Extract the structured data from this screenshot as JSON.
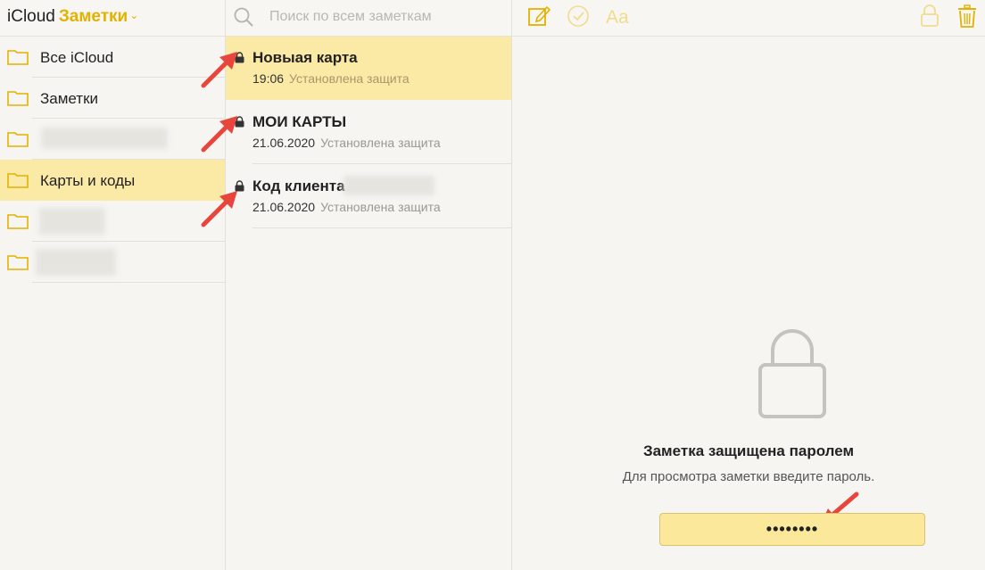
{
  "header": {
    "brand_icloud": "iCloud",
    "brand_notes": "Заметки",
    "brand_chevron": "⌄",
    "search_placeholder": "Поиск по всем заметкам"
  },
  "sidebar": {
    "folders": [
      {
        "label": "Все iCloud",
        "active": false
      },
      {
        "label": "Заметки",
        "active": false
      },
      {
        "label": "",
        "active": false,
        "redacted": true
      },
      {
        "label": "Карты и коды",
        "active": true
      },
      {
        "label": "",
        "active": false,
        "redacted": true
      },
      {
        "label": "",
        "active": false,
        "redacted": true
      }
    ]
  },
  "notes": [
    {
      "title": "Новыая карта",
      "date": "19:06",
      "status": "Установлена защита",
      "locked": true,
      "active": true
    },
    {
      "title": "МОИ КАРТЫ",
      "date": "21.06.2020",
      "status": "Установлена защита",
      "locked": true,
      "active": false
    },
    {
      "title": "Код клиента",
      "date": "21.06.2020",
      "status": "Установлена защита",
      "locked": true,
      "active": false,
      "title_partially_redacted": true
    }
  ],
  "locked_view": {
    "title": "Заметка защищена паролем",
    "subtitle": "Для просмотра заметки введите пароль.",
    "password_value": "••••••••"
  },
  "icons": [
    "folder-icon",
    "search-icon",
    "compose-icon",
    "checklist-icon",
    "format-icon",
    "lock-icon",
    "trash-icon"
  ],
  "colors": {
    "accent": "#e3b200",
    "selection": "#fbe9a6",
    "arrow": "#e8453c"
  }
}
